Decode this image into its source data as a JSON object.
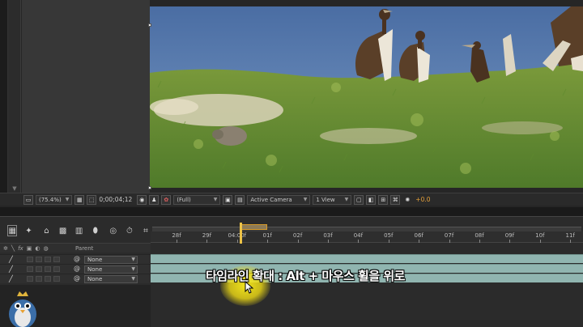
{
  "viewer_toolbar": {
    "zoom": "(75.4%)",
    "timecode": "0;00;04;12",
    "resolution": "(Full)",
    "camera": "Active Camera",
    "view": "1 View",
    "exposure": "+0.0"
  },
  "timeline": {
    "header_parent": "Parent",
    "ruler_ticks": [
      "28f",
      "29f",
      "04:00f",
      "01f",
      "02f",
      "03f",
      "04f",
      "05f",
      "06f",
      "07f",
      "08f",
      "09f",
      "10f",
      "11f"
    ],
    "layers": [
      {
        "parent": "None"
      },
      {
        "parent": "None"
      },
      {
        "parent": "None"
      }
    ]
  },
  "caption": "타임라인 확대 : Alt + 마우스 휠을 위로",
  "colors": {
    "accent": "#e5a13a",
    "track": "#90b5b0",
    "highlight": "#f0dc14"
  },
  "icons": [
    "snapshot-icon",
    "channel-icon",
    "region-icon",
    "grid-icon",
    "search-icon",
    "pen-icon",
    "spiral-icon",
    "mouse-pointer-icon"
  ]
}
